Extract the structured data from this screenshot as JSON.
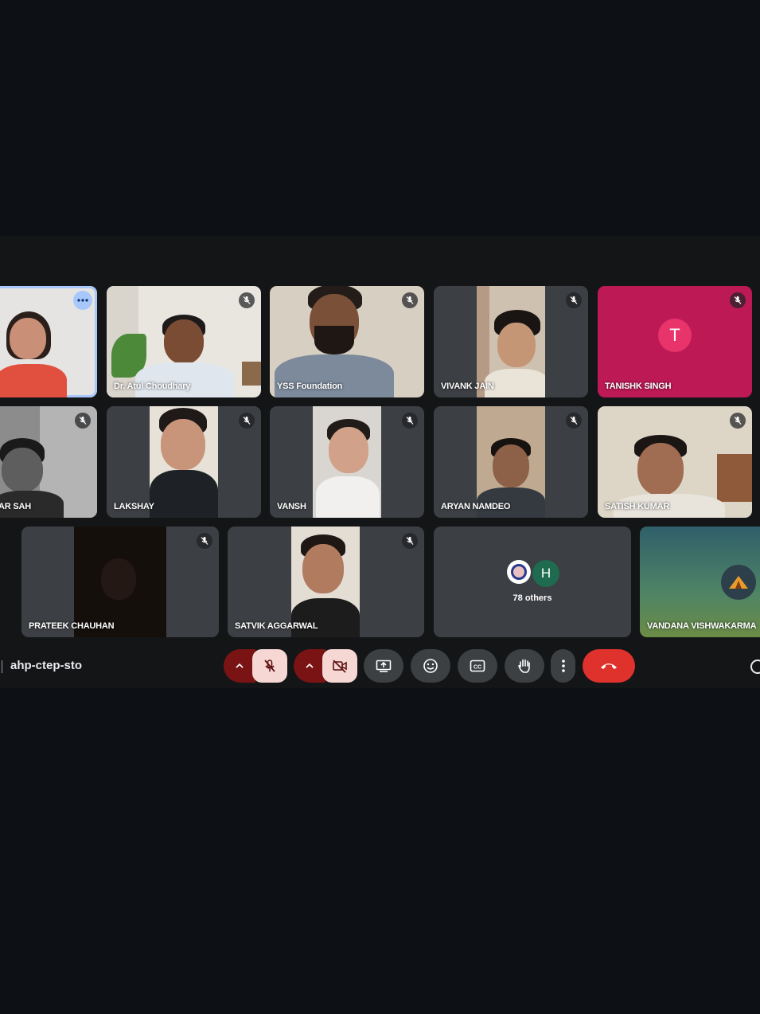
{
  "meeting": {
    "code": "ahp-ctep-sto"
  },
  "participants": [
    {
      "name": "",
      "muted": false
    },
    {
      "name": "Dr. Atul Choudhary",
      "muted": true
    },
    {
      "name": "YSS Foundation",
      "muted": true
    },
    {
      "name": "VIVANK JAIN",
      "muted": true
    },
    {
      "name": "TANISHK SINGH",
      "muted": true,
      "avatar_letter": "T",
      "avatar_color": "#e8336b",
      "tile_color": "#bd1a55"
    },
    {
      "name": "AR SAH",
      "muted": true
    },
    {
      "name": "LAKSHAY",
      "muted": true
    },
    {
      "name": "VANSH",
      "muted": true
    },
    {
      "name": "ARYAN NAMDEO",
      "muted": true
    },
    {
      "name": "SATISH KUMAR",
      "muted": true
    },
    {
      "name": "PRATEEK CHAUHAN",
      "muted": true
    },
    {
      "name": "SATVIK AGGARWAL",
      "muted": true
    },
    {
      "name": "VANDANA VISHWAKARMA",
      "muted": false
    }
  ],
  "others": {
    "label": "78 others",
    "avatar_letter": "H",
    "avatar_color": "#1e6b4f"
  },
  "controls": {
    "mic_state": "off",
    "camera_state": "off",
    "buttons": [
      "present-screen",
      "reactions",
      "captions",
      "raise-hand",
      "more-options",
      "leave-call"
    ]
  },
  "colors": {
    "end_call": "#e0322c",
    "toggle_off_dark": "#7a1414",
    "toggle_off_light": "#f6d7d4",
    "active_border": "#a8c7fa"
  }
}
